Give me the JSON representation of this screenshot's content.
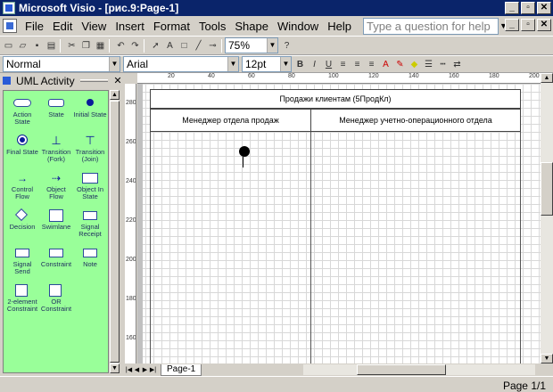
{
  "window": {
    "title": "Microsoft Visio - [рис.9:Page-1]"
  },
  "menu": {
    "items": [
      "File",
      "Edit",
      "View",
      "Insert",
      "Format",
      "Tools",
      "Shape",
      "Window",
      "Help"
    ]
  },
  "help_box": {
    "placeholder": "Type a question for help"
  },
  "toolbar": {
    "zoom": "75%"
  },
  "format_bar": {
    "style": "Normal",
    "font": "Arial",
    "size": "12pt"
  },
  "stencil": {
    "title": "UML Activity",
    "shapes": [
      "Action State",
      "State",
      "Initial State",
      "Final State",
      "Transition (Fork)",
      "Transition (Join)",
      "Control Flow",
      "Object Flow",
      "Object In State",
      "Decision",
      "Swimlane",
      "Signal Receipt",
      "Signal Send",
      "Constraint",
      "Note",
      "2-element Constraint",
      "OR Constraint"
    ]
  },
  "ruler": {
    "top_ticks": [
      "20",
      "40",
      "60",
      "80",
      "100",
      "120",
      "140",
      "160",
      "180",
      "200"
    ],
    "left_ticks": [
      "280",
      "260",
      "240",
      "220",
      "200",
      "180",
      "160"
    ]
  },
  "diagram": {
    "pool_title": "Продажи клиентам (5ПродКл)",
    "lanes": [
      "Менеджер отдела продаж",
      "Менеджер учетно-операционного отдела"
    ]
  },
  "page_tabs": [
    "Page-1"
  ],
  "status": {
    "page": "Page 1/1"
  }
}
